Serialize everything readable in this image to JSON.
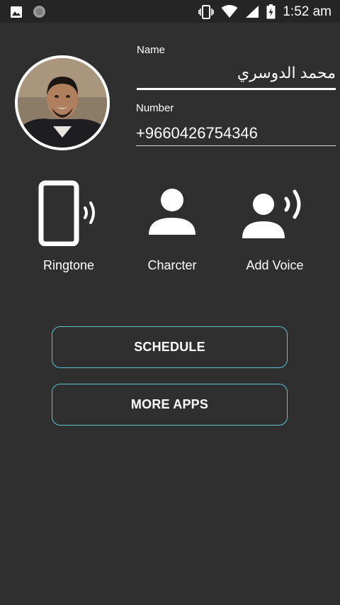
{
  "status_bar": {
    "time": "1:52 am",
    "left_icons": [
      "image-icon",
      "circle-icon"
    ],
    "right_icons": [
      "vibrate-icon",
      "wifi-icon",
      "signal-icon",
      "battery-charging-icon"
    ]
  },
  "contact": {
    "name_label": "Name",
    "name_value": "محمد الدوسري",
    "number_label": "Number",
    "number_value": "+9660426754346"
  },
  "features": [
    {
      "label": "Ringtone",
      "icon": "phone-ringing-icon"
    },
    {
      "label": "Charcter",
      "icon": "person-icon"
    },
    {
      "label": "Add Voice",
      "icon": "person-voice-icon"
    }
  ],
  "buttons": {
    "schedule": "SCHEDULE",
    "more_apps": "MORE APPS"
  },
  "colors": {
    "background": "#2f2f2f",
    "status_bar": "#252525",
    "button_border": "#5bc6cf"
  }
}
